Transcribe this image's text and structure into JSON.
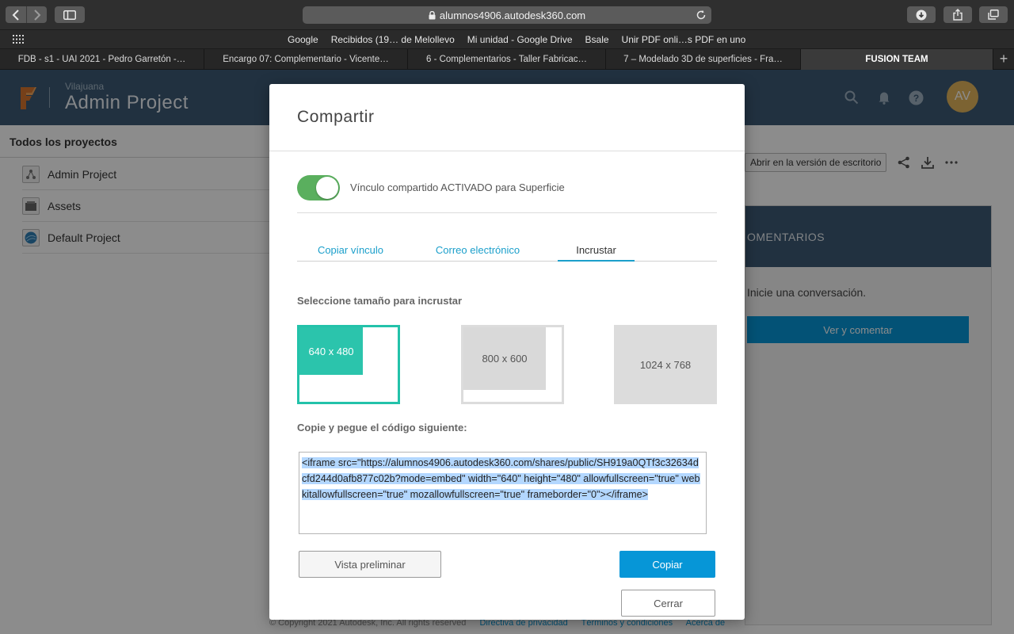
{
  "browser": {
    "url": "alumnos4906.autodesk360.com",
    "favorites": [
      "Google",
      "Recibidos (19… de Melollevo",
      "Mi unidad - Google Drive",
      "Bsale",
      "Unir PDF onli…s PDF en uno"
    ],
    "tabs": [
      {
        "label": "FDB - s1 - UAI 2021 - Pedro Garretón -…",
        "active": false
      },
      {
        "label": "Encargo 07: Complementario - Vicente…",
        "active": false
      },
      {
        "label": "6 - Complementarios - Taller Fabricac…",
        "active": false
      },
      {
        "label": "7 – Modelado 3D de superficies - Fra…",
        "active": false
      },
      {
        "label": "FUSION TEAM",
        "active": true
      }
    ]
  },
  "app": {
    "hub_name": "Vilajuana",
    "project_name": "Admin Project",
    "avatar_initials": "AV",
    "sidebar": {
      "title": "Todos los proyectos",
      "items": [
        {
          "label": "Admin Project",
          "icon": "hub-icon"
        },
        {
          "label": "Assets",
          "icon": "folder-icon"
        },
        {
          "label": "Default Project",
          "icon": "project-globe-icon"
        }
      ]
    },
    "open_desktop_label": "Abrir en la versión de escritorio",
    "comments": {
      "title": "OMENTARIOS",
      "empty_text": "Inicie una conversación.",
      "button_label": "Ver y comentar"
    },
    "footer": {
      "copyright": "© Copyright 2021 Autodesk, Inc. All rights reserved",
      "links": [
        "Directiva de privacidad",
        "Términos y condiciones",
        "Acerca de"
      ]
    }
  },
  "modal": {
    "title": "Compartir",
    "toggle_label": "Vínculo compartido ACTIVADO para Superficie",
    "toggle_on": true,
    "tabs": [
      {
        "label": "Copiar vínculo",
        "active": false
      },
      {
        "label": "Correo electrónico",
        "active": false
      },
      {
        "label": "Incrustar",
        "active": true
      }
    ],
    "size_label": "Seleccione tamaño para incrustar",
    "sizes": [
      {
        "label": "640 x 480",
        "selected": true
      },
      {
        "label": "800 x 600",
        "selected": false
      },
      {
        "label": "1024 x 768",
        "selected": false
      }
    ],
    "code_label": "Copie y pegue el código siguiente:",
    "embed_code": "<iframe src=\"https://alumnos4906.autodesk360.com/shares/public/SH919a0QTf3c32634dcfd244d0afb877c02b?mode=embed\" width=\"640\" height=\"480\" allowfullscreen=\"true\" webkitallowfullscreen=\"true\" mozallowfullscreen=\"true\" frameborder=\"0\"></iframe>",
    "preview_label": "Vista preliminar",
    "copy_label": "Copiar",
    "close_label": "Cerrar"
  },
  "colors": {
    "accent_blue": "#0696d7",
    "toggle_green": "#5aaf5e",
    "selected_teal": "#2bc4ac",
    "header_navy": "#3c5a75"
  }
}
